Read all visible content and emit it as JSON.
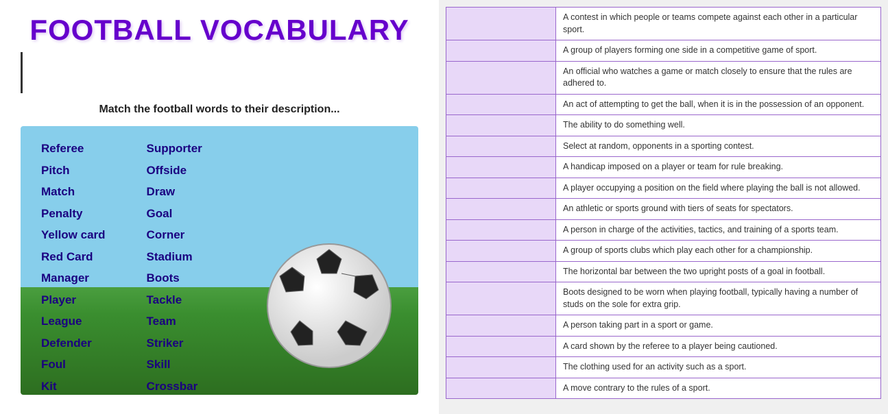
{
  "title": "FOOTBALL VOCABULARY",
  "instruction": "Match the football words to their description...",
  "leftBorderLine": true,
  "vocabCol1": [
    "Referee",
    "Pitch",
    "Match",
    "Penalty",
    "Yellow card",
    "Red Card",
    "Manager",
    "Player",
    "League",
    "Defender",
    "Foul",
    "Kit"
  ],
  "vocabCol2": [
    "Supporter",
    "Offside",
    "Draw",
    "Goal",
    "Corner",
    "Stadium",
    "Boots",
    "Tackle",
    "Team",
    "Striker",
    "Skill",
    "Crossbar"
  ],
  "definitions": [
    "A contest in which people or teams compete against each other in a particular sport.",
    "A group of players forming one side in a competitive game of sport.",
    "An official who watches a game or match closely to ensure that the rules are adhered to.",
    "An act of attempting to get the ball, when it is in the possession of an opponent.",
    "The ability to do something well.",
    "Select at random, opponents in a sporting contest.",
    "A handicap imposed on a player or team for rule breaking.",
    "A player occupying a position on the field where playing the ball is not allowed.",
    "An athletic or sports ground with tiers of seats for spectators.",
    "A person in charge of the activities, tactics, and training of a sports team.",
    "A group of sports clubs which play each other for a championship.",
    "The horizontal bar between the two upright posts of a goal in football.",
    "Boots designed to be worn when playing football, typically having a number of studs on the sole for extra grip.",
    "A person taking part in a sport or game.",
    "A card shown by the referee to a player being cautioned.",
    "The clothing used for an activity such as a sport.",
    "A move contrary to the rules of a sport."
  ]
}
